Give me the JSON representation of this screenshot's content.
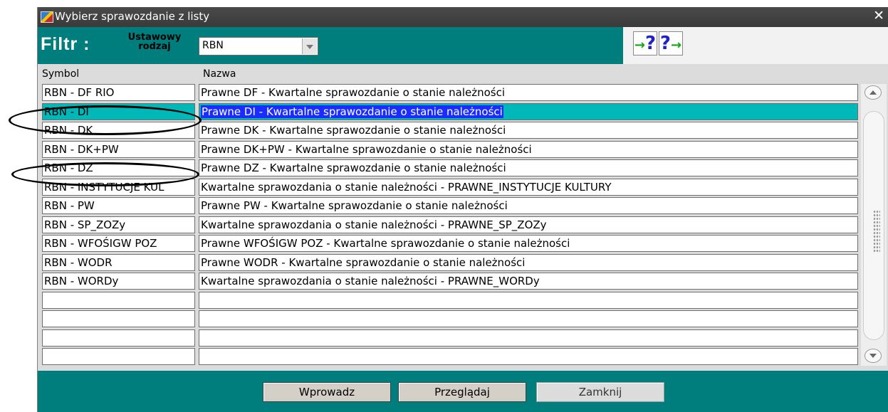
{
  "window": {
    "title": "Wybierz sprawozdanie z listy",
    "close_glyph": "✕"
  },
  "filter": {
    "label": "Filtr :",
    "sublabel": "Ustawowy rodzaj",
    "select_value": "RBN",
    "help_buttons": [
      {
        "icon": "help-prev-icon"
      },
      {
        "icon": "help-next-icon"
      }
    ]
  },
  "columns": {
    "symbol": "Symbol",
    "name": "Nazwa"
  },
  "rows": [
    {
      "symbol": "RBN - DF RIO",
      "name": "Prawne DF - Kwartalne sprawozdanie o stanie należności",
      "selected": false
    },
    {
      "symbol": "RBN - DI",
      "name": "Prawne DI - Kwartalne sprawozdanie o stanie należności",
      "selected": true
    },
    {
      "symbol": "RBN - DK",
      "name": "Prawne DK - Kwartalne sprawozdanie o stanie należności",
      "selected": false
    },
    {
      "symbol": "RBN - DK+PW",
      "name": "Prawne DK+PW - Kwartalne sprawozdanie o stanie należności",
      "selected": false
    },
    {
      "symbol": "RBN - DZ",
      "name": "Prawne DZ - Kwartalne sprawozdanie o stanie należności",
      "selected": false
    },
    {
      "symbol": "RBN - INSTYTUCJE KUL",
      "name": "Kwartalne sprawozdania o stanie należności - PRAWNE_INSTYTUCJE KULTURY",
      "selected": false
    },
    {
      "symbol": "RBN - PW",
      "name": "Prawne PW - Kwartalne sprawozdanie o stanie należności",
      "selected": false
    },
    {
      "symbol": "RBN - SP_ZOZy",
      "name": "Kwartalne sprawozdania o stanie należności - PRAWNE_SP_ZOZy",
      "selected": false
    },
    {
      "symbol": "RBN - WFOŚIGW POZ",
      "name": "Prawne WFOŚIGW POZ - Kwartalne sprawozdanie o stanie należności",
      "selected": false
    },
    {
      "symbol": "RBN - WODR",
      "name": "Prawne WODR - Kwartalne sprawozdanie o stanie należności",
      "selected": false
    },
    {
      "symbol": "RBN - WORDy",
      "name": "Kwartalne sprawozdania o stanie należności - PRAWNE_WORDy",
      "selected": false
    },
    {
      "symbol": "",
      "name": "",
      "selected": false
    },
    {
      "symbol": "",
      "name": "",
      "selected": false
    },
    {
      "symbol": "",
      "name": "",
      "selected": false
    },
    {
      "symbol": "",
      "name": "",
      "selected": false
    }
  ],
  "buttons": {
    "enter": "Wprowadz",
    "browse": "Przeglądaj",
    "close": "Zamknij"
  },
  "colors": {
    "teal": "#007e7e",
    "selection": "#1a2cff",
    "selected_row": "#00b8b8"
  }
}
